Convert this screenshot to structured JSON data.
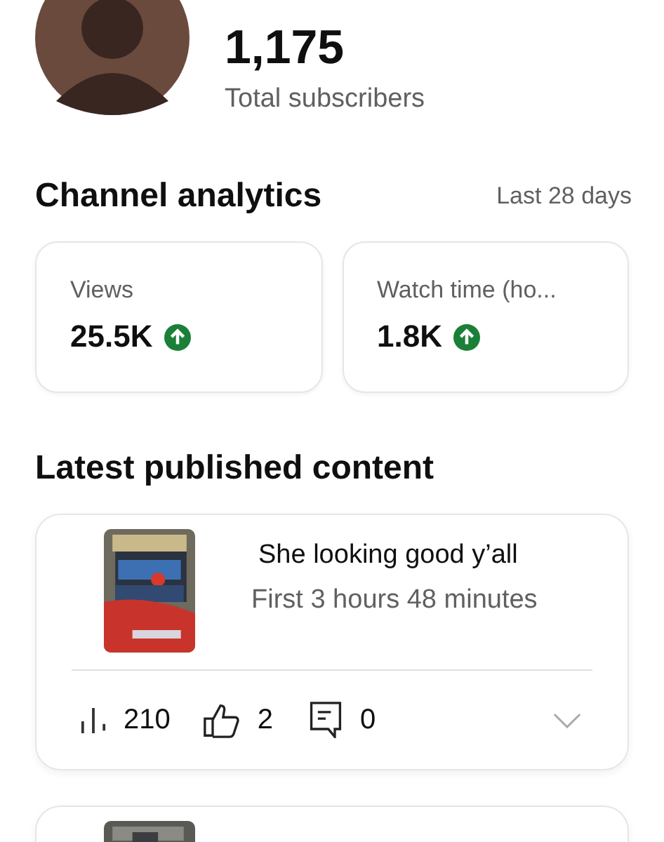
{
  "channel": {
    "subscriber_count": "1,175",
    "subscriber_label": "Total subscribers"
  },
  "analytics": {
    "title": "Channel analytics",
    "period": "Last 28 days",
    "metrics": [
      {
        "label": "Views",
        "value": "25.5K",
        "increased": true
      },
      {
        "label": "Watch time (ho...",
        "value": "1.8K",
        "increased": true
      }
    ]
  },
  "latest": {
    "title": "Latest published content",
    "items": [
      {
        "title": "She looking good y’all",
        "subtitle": "First 3 hours 48 minutes",
        "views": "210",
        "likes": "2",
        "comments": "0"
      },
      {
        "kind": "picture"
      }
    ]
  }
}
